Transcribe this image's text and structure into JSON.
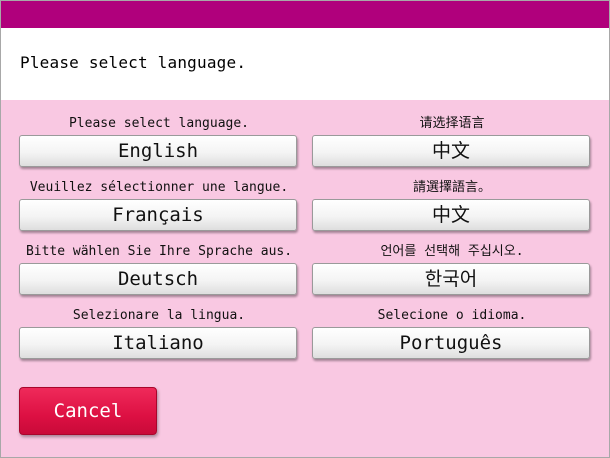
{
  "header": {
    "title": "Please select language."
  },
  "languages": [
    {
      "prompt": "Please select language.",
      "label": "English"
    },
    {
      "prompt": "请选择语言",
      "label": "中文"
    },
    {
      "prompt": "Veuillez sélectionner une langue.",
      "label": "Français"
    },
    {
      "prompt": "請選擇語言。",
      "label": "中文"
    },
    {
      "prompt": "Bitte wählen Sie Ihre Sprache aus.",
      "label": "Deutsch"
    },
    {
      "prompt": "언어를 선택해 주십시오.",
      "label": "한국어"
    },
    {
      "prompt": "Selezionare la lingua.",
      "label": "Italiano"
    },
    {
      "prompt": "Selecione o idioma.",
      "label": "Português"
    }
  ],
  "actions": {
    "cancel_label": "Cancel"
  },
  "colors": {
    "top_bar": "#b0007c",
    "panel_background": "#f9c8e2",
    "cancel_button": "#dd1043"
  }
}
